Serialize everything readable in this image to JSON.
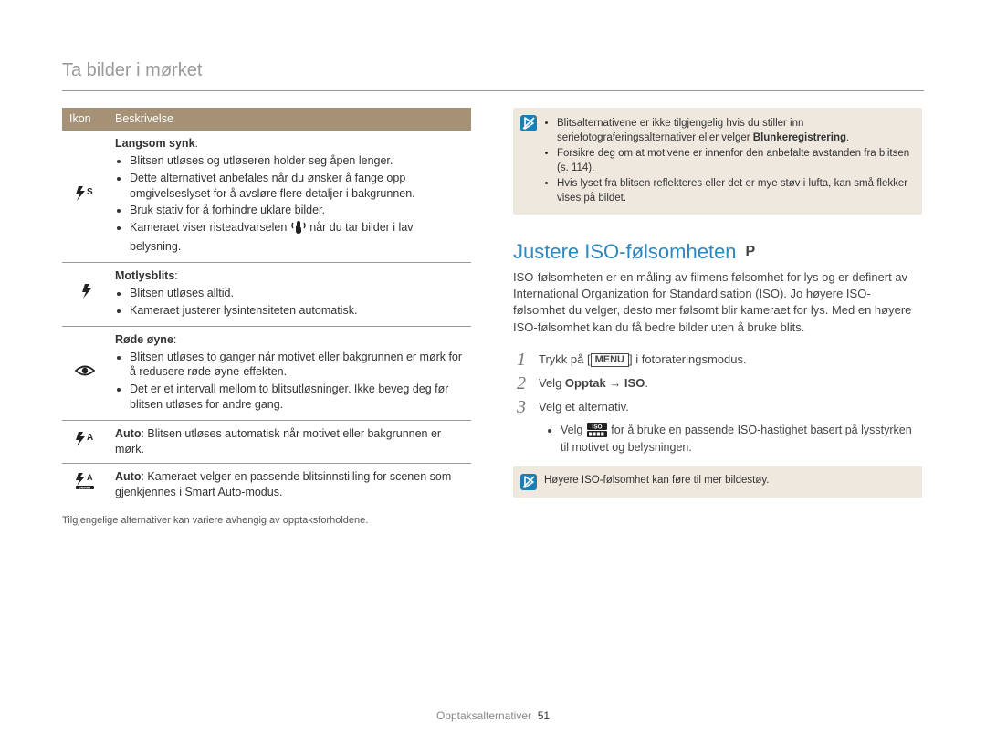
{
  "page_title": "Ta bilder i mørket",
  "table": {
    "headers": {
      "ikon": "Ikon",
      "beskrivelse": "Beskrivelse"
    },
    "rows": [
      {
        "icon_label": "slow-sync-flash-icon",
        "title": "Langsom synk",
        "bullets": [
          "Blitsen utløses og utløseren holder seg åpen lenger.",
          "Dette alternativet anbefales når du ønsker å fange opp omgivelseslyset for å avsløre flere detaljer i bakgrunnen.",
          "Bruk stativ for å forhindre uklare bilder.",
          "Kameraet viser risteadvarselen  når du tar bilder i lav belysning."
        ]
      },
      {
        "icon_label": "fill-in-flash-icon",
        "title": "Motlysblits",
        "bullets": [
          "Blitsen utløses alltid.",
          "Kameraet justerer lysintensiteten automatisk."
        ]
      },
      {
        "icon_label": "red-eye-icon",
        "title": "Røde øyne",
        "bullets": [
          "Blitsen utløses to ganger når motivet eller bakgrunnen er mørk for å redusere røde øyne-effekten.",
          "Det er et intervall mellom to blitsutløsninger. Ikke beveg deg før blitsen utløses for andre gang."
        ]
      },
      {
        "icon_label": "auto-flash-icon",
        "auto_label": "Auto",
        "plain": ": Blitsen utløses automatisk når motivet eller bakgrunnen er mørk."
      },
      {
        "icon_label": "smart-auto-flash-icon",
        "auto_label": "Auto",
        "plain": ": Kameraet velger en passende blitsinnstilling for scenen som gjenkjennes i Smart Auto-modus."
      }
    ]
  },
  "footnote": "Tilgjengelige alternativer kan variere avhengig av opptaksforholdene.",
  "note1": {
    "items_a": "Blitsalternativene er ikke tilgjengelig hvis du stiller inn seriefotograferingsalternativer eller velger ",
    "items_a_bold": "Blunkeregistrering",
    "items_b": "Forsikre deg om at motivene er innenfor den anbefalte avstanden fra blitsen (s. 114).",
    "items_c": "Hvis lyset fra blitsen reflekteres eller det er mye støv i lufta, kan små flekker vises på bildet."
  },
  "iso": {
    "heading": "Justere ISO-følsomheten",
    "mode": "P",
    "para": "ISO-følsomheten er en måling av filmens følsomhet for lys og er definert av International Organization for Standardisation (ISO). Jo høyere ISO-følsomhet du velger, desto mer følsomt blir kameraet for lys. Med en høyere ISO-følsomhet kan du få bedre bilder uten å bruke blits.",
    "steps": {
      "s1_pre": "Trykk på [",
      "s1_menu": "MENU",
      "s1_post": "] i fotorateringsmodus.",
      "s2_pre": "Velg ",
      "s2_bold": "Opptak → ISO",
      "s2_post": ".",
      "s3": "Velg et alternativ."
    },
    "sub_bullet": "Velg  for å bruke en passende ISO-hastighet basert på lysstyrken til motivet og belysningen.",
    "note": "Høyere ISO-følsomhet kan føre til mer bildestøy."
  },
  "footer": {
    "section": "Opptaksalternativer",
    "page": "51"
  }
}
